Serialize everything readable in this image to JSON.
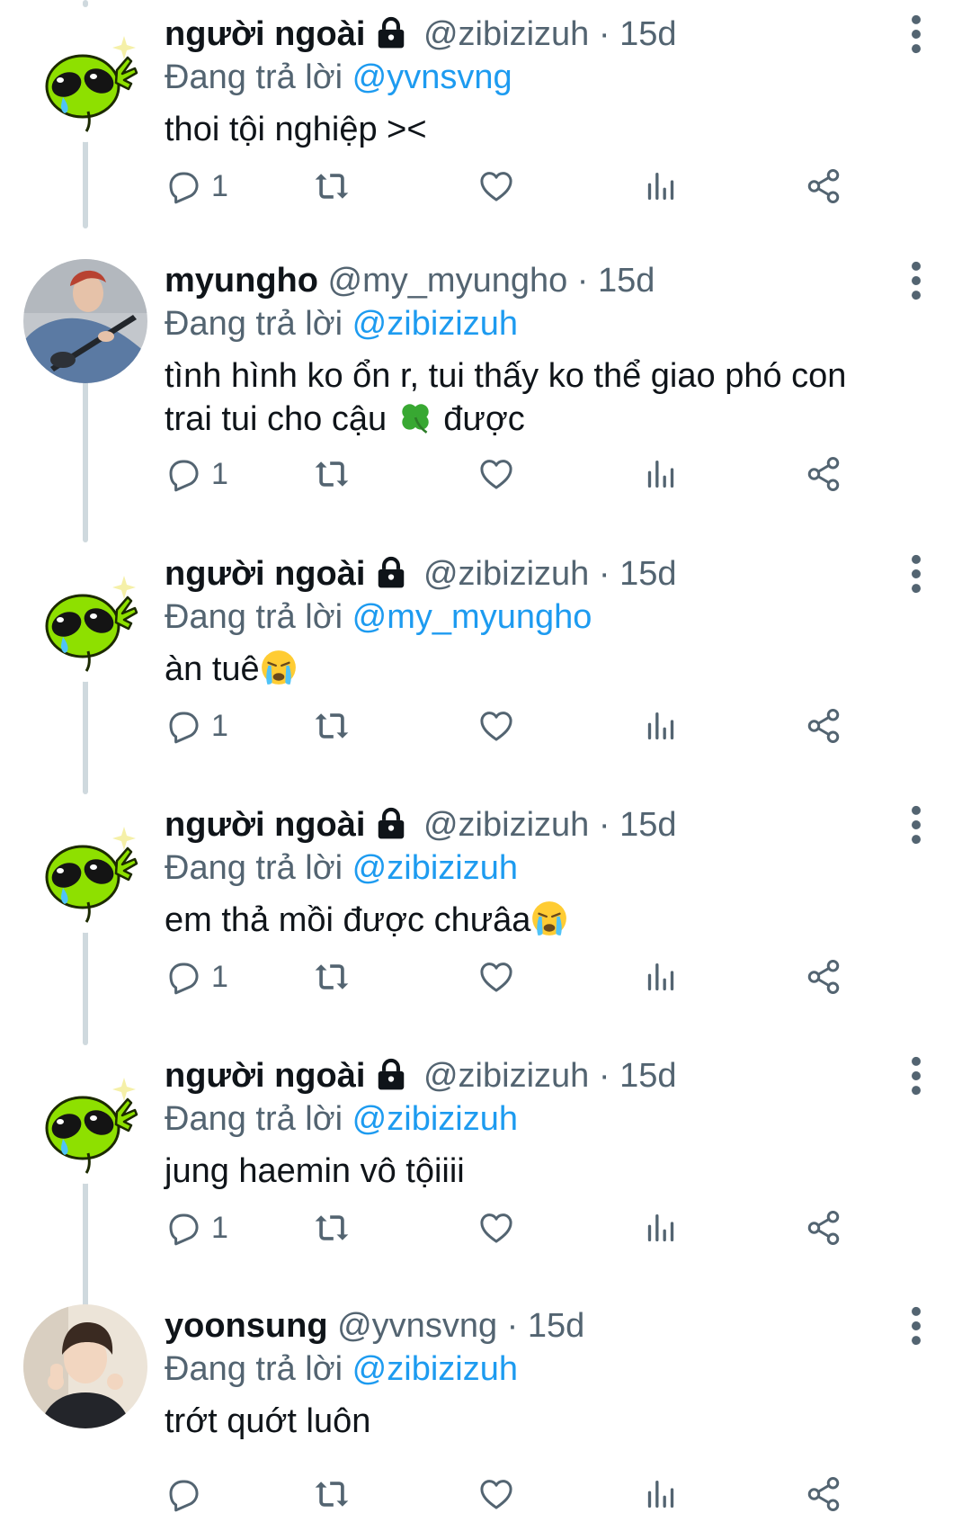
{
  "colors": {
    "text": "#0f1419",
    "secondary": "#536471",
    "link": "#1d9bf0",
    "thread_line": "#cfd9de",
    "alien_green": "#8ee000"
  },
  "icons": {
    "reply": "reply-icon",
    "retweet": "retweet-icon",
    "like": "heart-icon",
    "views": "views-icon",
    "share": "share-icon",
    "more": "more-icon",
    "locked": "lock-icon"
  },
  "tweets": [
    {
      "name": "người ngoài",
      "handle": "@zibizizuh",
      "dot": "·",
      "time": "15d",
      "reply_prefix": "Đang trả lời",
      "reply_to": "@yvnsvng",
      "text": "thoi tội nghiệp ><",
      "reply_count": "1"
    },
    {
      "name": "myungho",
      "handle": "@my_myungho",
      "dot": "·",
      "time": "15d",
      "reply_prefix": "Đang trả lời",
      "reply_to": "@zibizizuh",
      "text_line1": "tình hình ko ổn r, tui thấy ko thể giao phó con",
      "text_line2a": "trai tui cho cậu ",
      "text_line2_emoji": "🍀",
      "text_line2b": " được",
      "reply_count": "1"
    },
    {
      "name": "người ngoài",
      "handle": "@zibizizuh",
      "dot": "·",
      "time": "15d",
      "reply_prefix": "Đang trả lời",
      "reply_to": "@my_myungho",
      "text": "àn tuê",
      "text_emoji": "😭",
      "reply_count": "1"
    },
    {
      "name": "người ngoài",
      "handle": "@zibizizuh",
      "dot": "·",
      "time": "15d",
      "reply_prefix": "Đang trả lời",
      "reply_to": "@zibizizuh",
      "text": "em thả mồi được chưâa",
      "text_emoji": "😭",
      "reply_count": "1"
    },
    {
      "name": "người ngoài",
      "handle": "@zibizizuh",
      "dot": "·",
      "time": "15d",
      "reply_prefix": "Đang trả lời",
      "reply_to": "@zibizizuh",
      "text": "jung haemin vô tộiiii",
      "reply_count": "1"
    },
    {
      "name": "yoonsung",
      "handle": "@yvnsvng",
      "dot": "·",
      "time": "15d",
      "reply_prefix": "Đang trả lời",
      "reply_to": "@zibizizuh",
      "text": "trớt quớt luôn"
    }
  ]
}
